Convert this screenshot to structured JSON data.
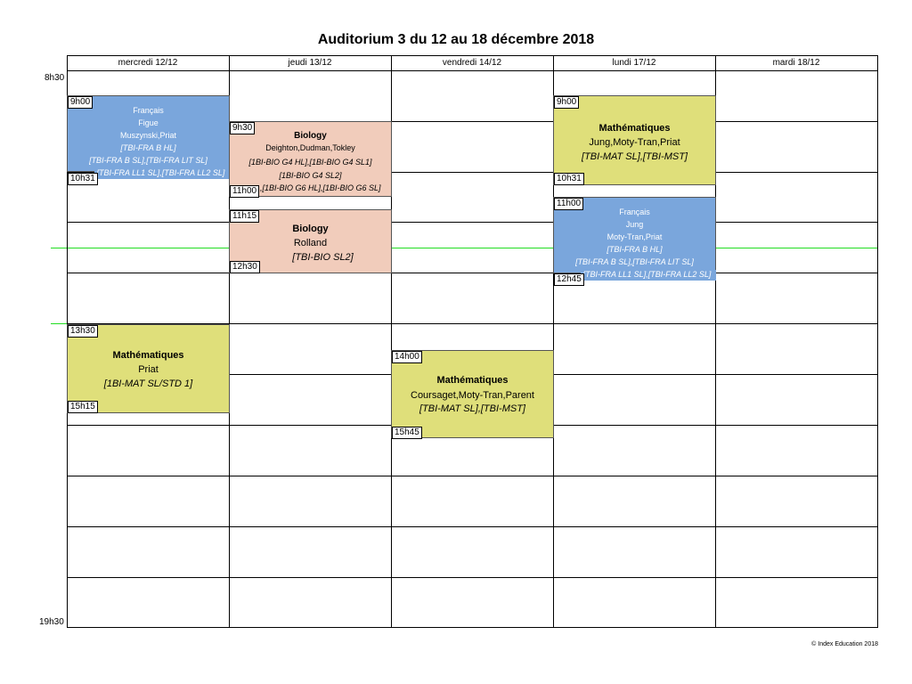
{
  "title": "Auditorium 3 du 12 au 18 décembre 2018",
  "days": [
    "mercredi 12/12",
    "jeudi 13/12",
    "vendredi 14/12",
    "lundi 17/12",
    "mardi 18/12"
  ],
  "time_axis": {
    "start": "8h30",
    "end": "19h30"
  },
  "events": [
    {
      "start": "9h00",
      "end": "10h31",
      "color": "#7aa6dc",
      "lines": [
        "Français",
        "Figue",
        "Muszynski,Priat",
        "[TBI-FRA B HL]",
        "[TBI-FRA B SL],[TBI-FRA LIT SL]",
        ",[TBI-FRA LL1 SL],[TBI-FRA LL2 SL]"
      ]
    },
    {
      "start": "9h30",
      "end": "11h00",
      "color": "#f1ccbb",
      "lines": [
        "Biology",
        "Deighton,Dudman,Tokley",
        "[1BI-BIO G4 HL],[1BI-BIO G4 SL1]",
        "[1BI-BIO G4 SL2]",
        ",[1BI-BIO G6 HL],[1BI-BIO G6 SL]"
      ]
    },
    {
      "start": "11h15",
      "end": "12h30",
      "color": "#f1ccbb",
      "lines": [
        "Biology",
        "Rolland",
        "[TBI-BIO  SL2]"
      ]
    },
    {
      "start": "13h30",
      "end": "15h15",
      "color": "#dfdf7a",
      "lines": [
        "Mathématiques",
        "Priat",
        "[1BI-MAT SL/STD 1]"
      ]
    },
    {
      "start": "14h00",
      "end": "15h45",
      "color": "#dfdf7a",
      "lines": [
        "Mathématiques",
        "Coursaget,Moty-Tran,Parent",
        "[TBI-MAT SL],[TBI-MST]"
      ]
    },
    {
      "start": "9h00",
      "end": "10h31",
      "color": "#dfdf7a",
      "lines": [
        "Mathématiques",
        "Jung,Moty-Tran,Priat",
        "[TBI-MAT SL],[TBI-MST]"
      ]
    },
    {
      "start": "11h00",
      "end": "12h45",
      "color": "#7aa6dc",
      "lines": [
        "Français",
        "Jung",
        "Moty-Tran,Priat",
        "[TBI-FRA B HL]",
        "[TBI-FRA B SL],[TBI-FRA LIT SL]",
        ",[TBI-FRA LL1 SL],[TBI-FRA LL2 SL]"
      ]
    }
  ],
  "footer": "© Index Education 2018"
}
